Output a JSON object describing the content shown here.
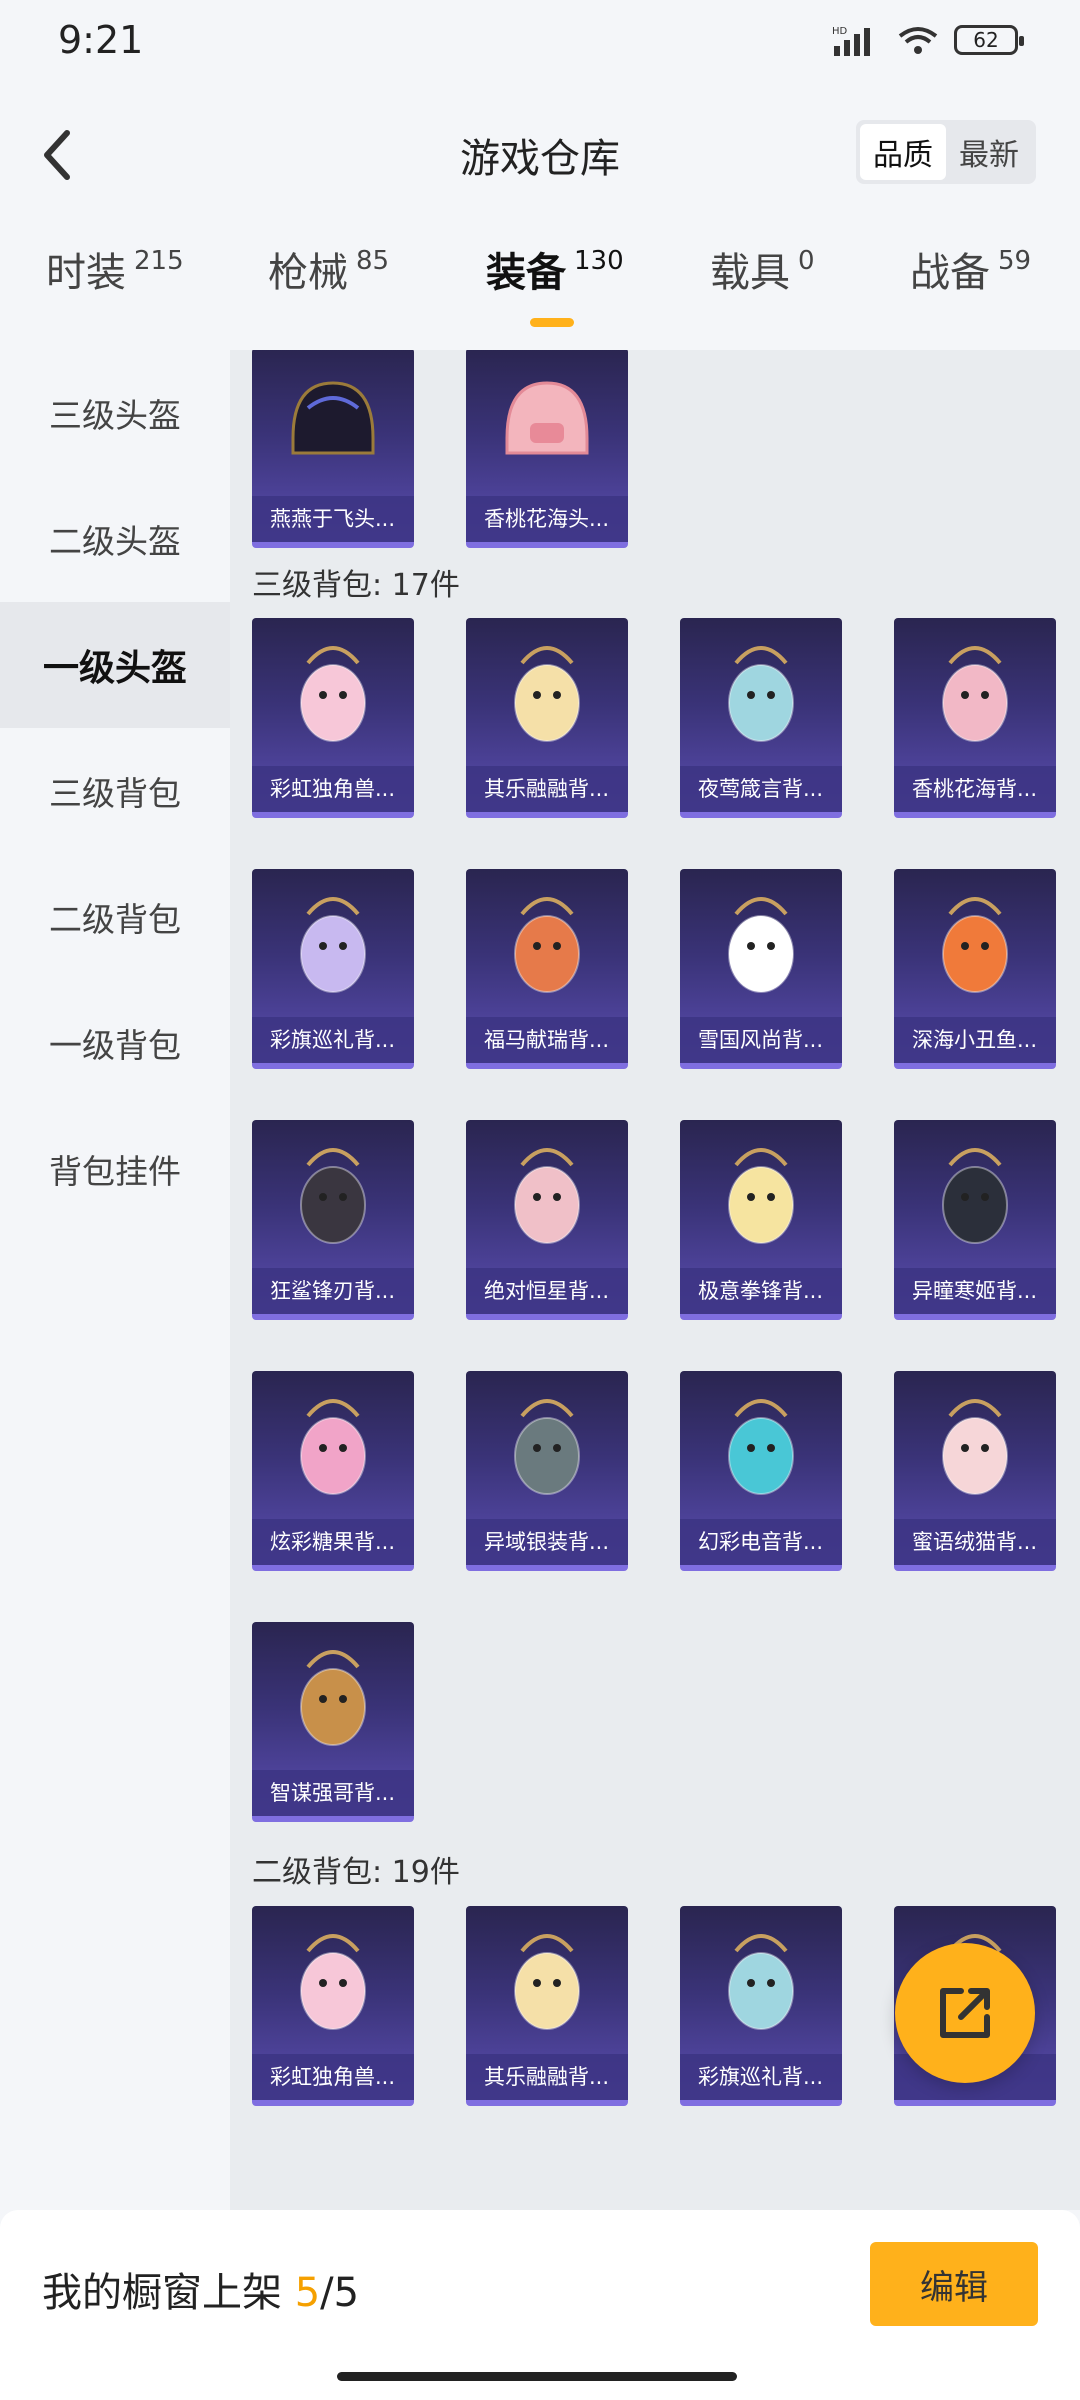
{
  "status_bar": {
    "time": "9:21",
    "battery": "62"
  },
  "header": {
    "title": "游戏仓库",
    "sort_options": [
      "品质",
      "最新"
    ]
  },
  "tabs": [
    {
      "label": "时装",
      "count": "215"
    },
    {
      "label": "枪械",
      "count": "85"
    },
    {
      "label": "装备",
      "count": "130"
    },
    {
      "label": "载具",
      "count": "0"
    },
    {
      "label": "战备",
      "count": "59"
    }
  ],
  "sidebar": {
    "items": [
      "三级头盔",
      "二级头盔",
      "一级头盔",
      "三级背包",
      "二级背包",
      "一级背包",
      "背包挂件"
    ]
  },
  "sections": {
    "helmets_partial": [
      "燕燕于飞头...",
      "香桃花海头..."
    ],
    "backpack3": {
      "title": "三级背包: 17件",
      "items": [
        "彩虹独角兽...",
        "其乐融融背...",
        "夜莺箴言背...",
        "香桃花海背...",
        "彩旗巡礼背...",
        "福马献瑞背...",
        "雪国风尚背...",
        "深海小丑鱼...",
        "狂鲨锋刃背...",
        "绝对恒星背...",
        "极意拳锋背...",
        "异瞳寒姬背...",
        "炫彩糖果背...",
        "异域银装背...",
        "幻彩电音背...",
        "蜜语绒猫背...",
        "智谋强哥背..."
      ]
    },
    "backpack2": {
      "title": "二级背包: 19件",
      "items": [
        "彩虹独角兽...",
        "其乐融融背...",
        "彩旗巡礼背...",
        ""
      ]
    }
  },
  "bottom": {
    "prefix": "我的橱窗上架 ",
    "current": "5",
    "total": "/5",
    "edit_label": "编辑"
  },
  "colors": {
    "accent": "#ffb11b",
    "card_bg": "#3a3378"
  }
}
